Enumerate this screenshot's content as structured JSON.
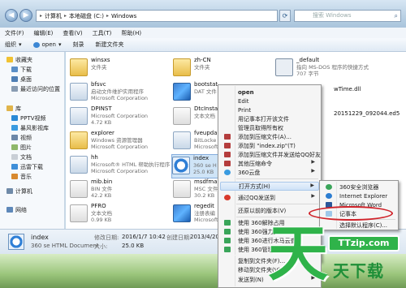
{
  "address": {
    "crumbs": [
      "计算机",
      "本地磁盘 (C:)",
      "Windows"
    ],
    "search_placeholder": "搜索 Windows"
  },
  "menubar": [
    "文件(F)",
    "编辑(E)",
    "查看(V)",
    "工具(T)",
    "帮助(H)"
  ],
  "toolbar": {
    "organize": "组织",
    "open": "open",
    "share": "刻录",
    "new_folder": "新建文件夹"
  },
  "nav": {
    "favorites": "收藏夹",
    "fav_items": [
      "下载",
      "桌面",
      "最近访问的位置"
    ],
    "library": "库",
    "lib_items": [
      "PPTV视频",
      "暴风影视库",
      "视频",
      "图片",
      "文档",
      "迅雷下载",
      "音乐"
    ],
    "computer": "计算机",
    "network": "网络"
  },
  "files": [
    {
      "name": "winsxs",
      "sub": "文件夹"
    },
    {
      "name": "bfsvc",
      "sub": "启动文件维护实用程序",
      "sub2": "Microsoft Corporation"
    },
    {
      "name": "DPINST",
      "sub": "Microsoft Corporation",
      "sub2": "4.72 KB"
    },
    {
      "name": "explorer",
      "sub": "Windows 资源管理器",
      "sub2": "Microsoft Corporation"
    },
    {
      "name": "hh",
      "sub": "Microsoft® HTML 帮助执行程序",
      "sub2": "Microsoft Corporation"
    },
    {
      "name": "mib.bin",
      "sub": "BIN 文件",
      "sub2": "42.2 KB"
    },
    {
      "name": "PFRO",
      "sub": "文本文档",
      "sub2": "0.99 KB"
    },
    {
      "name": "zh-CN",
      "sub": "文件夹"
    },
    {
      "name": "bootstat",
      "sub": "DAT 文件"
    },
    {
      "name": "DtcInsta",
      "sub": "文本文档"
    },
    {
      "name": "fveupda",
      "sub": "BitLocke",
      "sub2": "Microsoft"
    },
    {
      "name": "index",
      "sub": "360 se H",
      "sub2": "25.0 KB"
    },
    {
      "name": "msdfma",
      "sub": "MSC 文件",
      "sub2": "30.2 KB"
    },
    {
      "name": "regedit",
      "sub": "注册表编",
      "sub2": "Microsoft"
    },
    {
      "name": "_default",
      "sub": "指向 MS-DOS 程序的快捷方式",
      "sub2": "707 字节"
    },
    {
      "name": "wTime.dll",
      "sub": ""
    },
    {
      "name": "20151229_092044.ed5",
      "sub": ""
    }
  ],
  "context_menu": [
    {
      "label": "open",
      "bold": true
    },
    {
      "label": "Edit"
    },
    {
      "label": "Print"
    },
    {
      "label": "用记事本打开该文件"
    },
    {
      "label": "管理员取得所有权"
    },
    {
      "label": "添加到压缩文件(A)..."
    },
    {
      "label": "添加到 \"index.zip\"(T)"
    },
    {
      "label": "添加到压缩文件并发送给QQ好友"
    },
    {
      "label": "其他压缩命令",
      "arrow": true
    },
    {
      "label": "360云盘",
      "arrow": true
    },
    {
      "label": "打开方式(H)",
      "arrow": true
    },
    {
      "label": "通过QQ发送到",
      "arrow": true
    },
    {
      "label": "还原以前的版本(V)"
    },
    {
      "label": "使用 360解除占用"
    },
    {
      "label": "使用 360强力删除"
    },
    {
      "label": "使用 360进行木马云查杀"
    },
    {
      "label": "使用 360管理右键菜单"
    },
    {
      "label": "复制到文件夹(F)..."
    },
    {
      "label": "移动到文件夹(V)..."
    },
    {
      "label": "发送到(N)",
      "arrow": true
    }
  ],
  "open_with_menu": [
    {
      "label": "360安全浏览器"
    },
    {
      "label": "Internet Explorer"
    },
    {
      "label": "Microsoft Word"
    },
    {
      "label": "记事本"
    },
    {
      "label": "选择默认程序(C)..."
    }
  ],
  "details": {
    "name": "index",
    "type": "360 se HTML Document",
    "modified_label": "修改日期:",
    "modified_value": "2016/1/7 10:42",
    "size_label": "大小:",
    "size_value": "25.0 KB",
    "created_label": "创建日期:",
    "created_value": "2013/4/20"
  },
  "watermark": {
    "big": "天",
    "badge": "TTzip.com",
    "small": "天下载"
  },
  "colors": {
    "accent": "#2fb34a",
    "highlight_circle": "#d0232a",
    "selection": "#cfe4f7"
  }
}
